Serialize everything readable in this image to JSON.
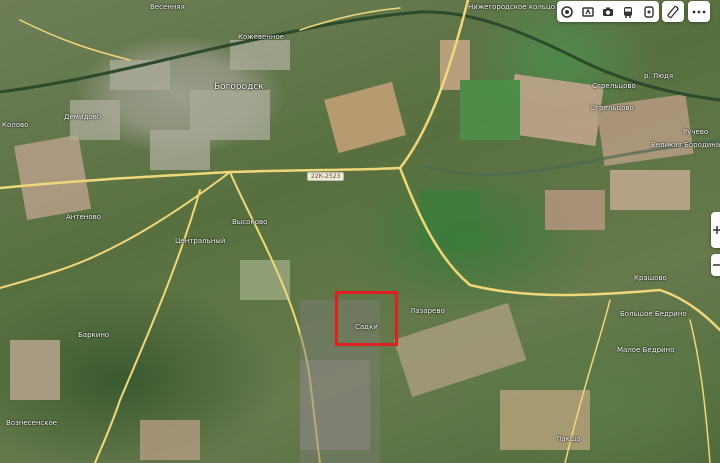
{
  "map": {
    "type": "satellite",
    "road_badge": "22К-2523",
    "place_labels": [
      {
        "key": "vesenneye",
        "text": "Весенняя"
      },
      {
        "key": "kozhevennoye",
        "text": "Кожевенное"
      },
      {
        "key": "bogorodsk",
        "text": "Богородск"
      },
      {
        "key": "demidovo",
        "text": "Демидово"
      },
      {
        "key": "kolovo",
        "text": "Колово"
      },
      {
        "key": "antenovo",
        "text": "Антеново"
      },
      {
        "key": "tsentralny",
        "text": "Центральный"
      },
      {
        "key": "vysokovo",
        "text": "Высоково"
      },
      {
        "key": "sadki",
        "text": "Садки"
      },
      {
        "key": "lazarevo",
        "text": "Лазарево"
      },
      {
        "key": "barkino",
        "text": "Баркино"
      },
      {
        "key": "voznesenskoye",
        "text": "Вознесенское"
      },
      {
        "key": "streltsovo_top",
        "text": "Стрельцово"
      },
      {
        "key": "streltsovo",
        "text": "Стрельцово"
      },
      {
        "key": "ruchevo",
        "text": "Ручево"
      },
      {
        "key": "velikie_borodino",
        "text": "Великая Бородина"
      },
      {
        "key": "krashovo",
        "text": "Крашово"
      },
      {
        "key": "bolshoe_bedrino",
        "text": "Большое Бедрино"
      },
      {
        "key": "maloe_bedrino",
        "text": "Малое Бедрино"
      },
      {
        "key": "lakshi",
        "text": "Лакша"
      },
      {
        "key": "nizhegorodskoe_koltso",
        "text": "Нижегородское кольцо"
      },
      {
        "key": "r_lyudya",
        "text": "р. Людя"
      }
    ],
    "highlight": {
      "label": "Садки",
      "color": "#e02020"
    }
  },
  "toolbar": {
    "buttons": [
      {
        "key": "layers",
        "icon": "layers-icon"
      },
      {
        "key": "panorama",
        "icon": "panorama-icon"
      },
      {
        "key": "photo",
        "icon": "camera-icon"
      },
      {
        "key": "transit",
        "icon": "bus-icon"
      },
      {
        "key": "traffic",
        "icon": "traffic-icon"
      }
    ],
    "ruler_icon": "ruler-icon",
    "more_icon": "more-icon"
  },
  "zoom": {
    "in_icon": "plus-icon",
    "out_icon": "minus-icon"
  },
  "colors": {
    "road": "#f0d77a",
    "railway": "#2c4a2c",
    "marker": "#e02020"
  }
}
